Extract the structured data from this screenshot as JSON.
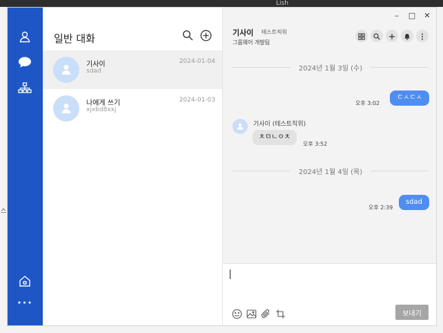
{
  "background": {
    "fragment_top": "Lish",
    "fragment_left": "스"
  },
  "window_controls": {
    "minimize": "–",
    "maximize": "□",
    "close": "✕"
  },
  "rail": {
    "items": [
      {
        "icon": "person-icon"
      },
      {
        "icon": "chat-bubble-icon"
      },
      {
        "icon": "org-chart-icon"
      }
    ],
    "bottom": [
      {
        "icon": "home-icon"
      },
      {
        "icon": "more-dots-icon",
        "glyph": "•••"
      }
    ]
  },
  "list": {
    "title": "일반 대화",
    "rooms": [
      {
        "name": "기사이",
        "preview": "sdad",
        "date": "2024-01-04",
        "active": true
      },
      {
        "name": "나에게 쓰기",
        "preview": "xjxbd8xxj",
        "date": "2024-01-03",
        "active": false
      }
    ]
  },
  "chat": {
    "name": "기사이",
    "position": "테스트직위",
    "department": "그룹웨어 개발팀",
    "dates": [
      "2024년 1월 3일 (수)",
      "2024년 1월 4일 (목)"
    ],
    "messages": [
      {
        "direction": "out",
        "text": "ㄷㅅㄷㅅ",
        "time": "오후 3:02"
      },
      {
        "direction": "in",
        "sender": "기사이 (테스트직위)",
        "text": "ㅊㅁㄴㅇㅊ",
        "time": "오후 3:52"
      },
      {
        "direction": "out",
        "text": "sdad",
        "time": "오후 2:39"
      }
    ],
    "composer": {
      "value": "",
      "send_label": "보내기"
    }
  },
  "colors": {
    "rail": "#1e56c6",
    "bubble_out": "#4f8ef0",
    "bubble_in": "#e2e2e2",
    "avatar": "#c9def9",
    "send_button": "#a6a6a6"
  }
}
